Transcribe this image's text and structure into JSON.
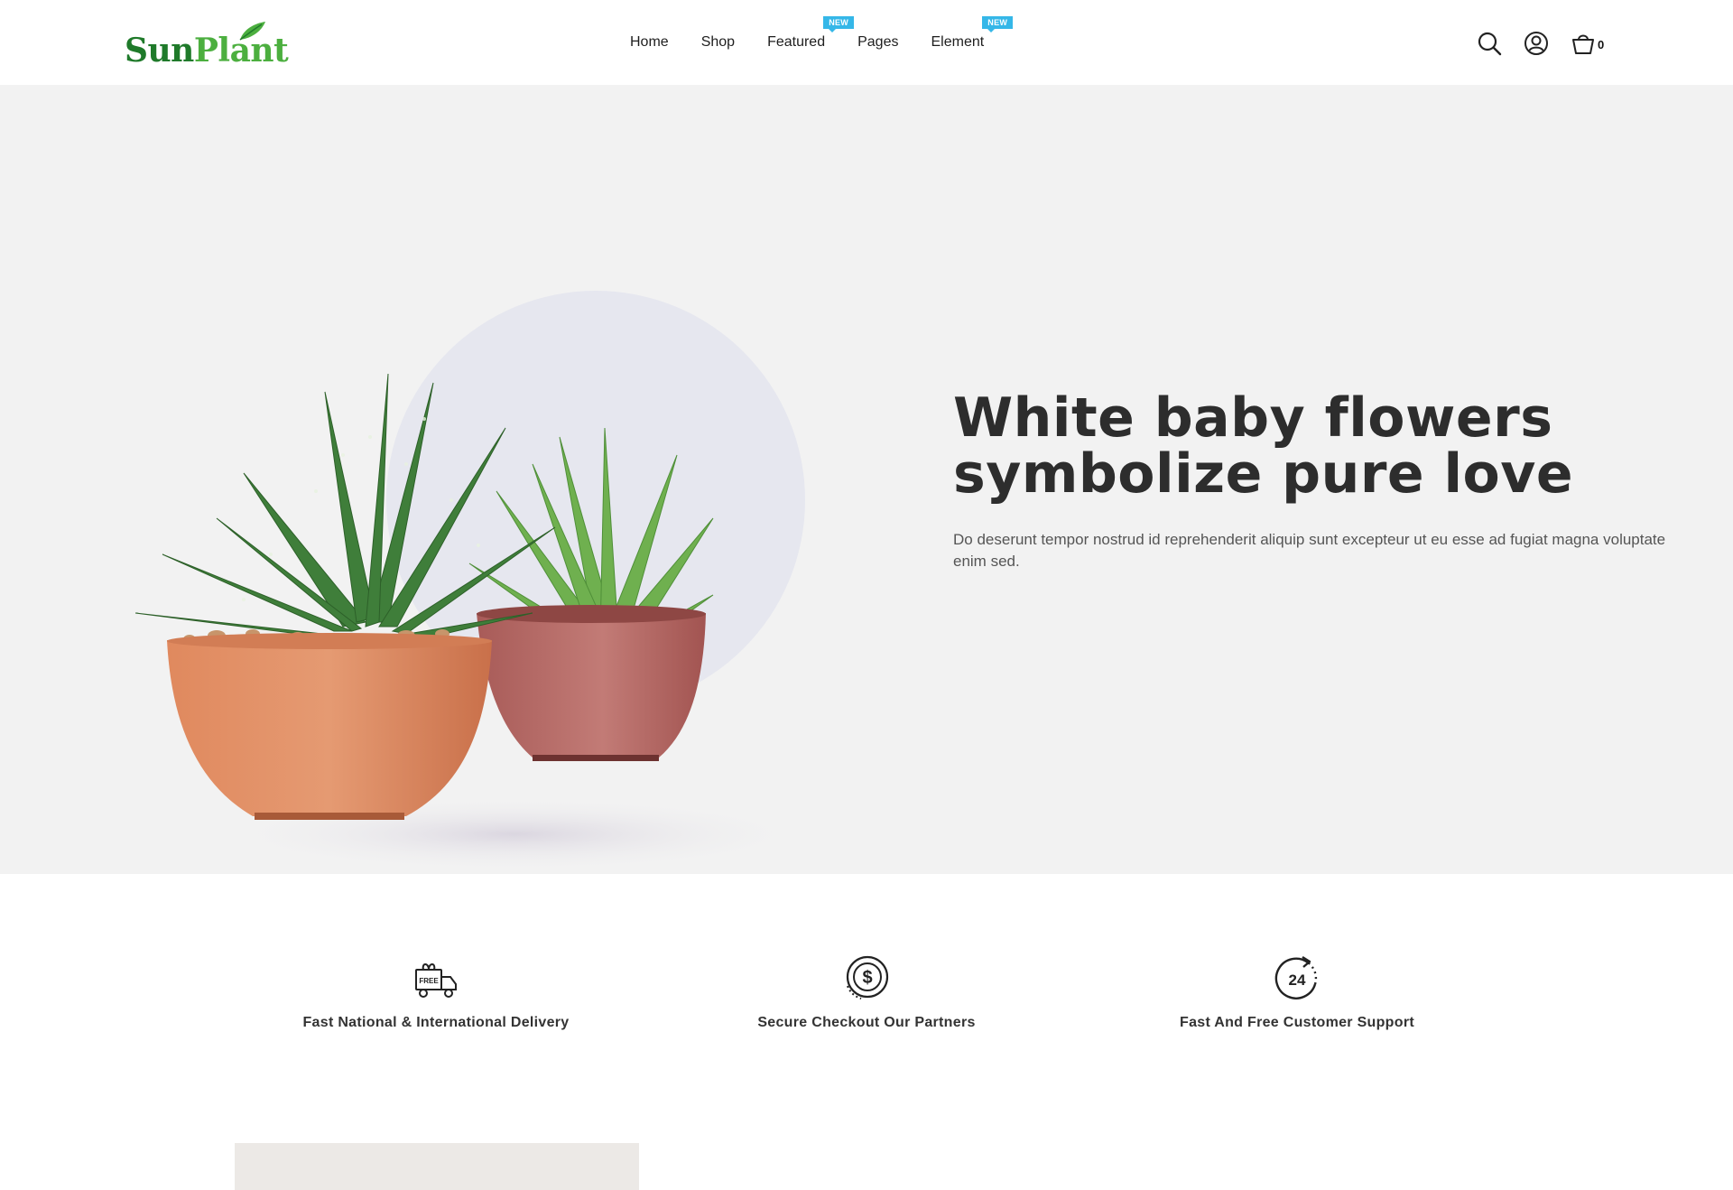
{
  "brand": {
    "name_part1": "Sun",
    "name_part2": "Plant",
    "color_dark": "#1f7a2a",
    "color_light": "#4caf3f"
  },
  "nav": {
    "items": [
      {
        "label": "Home"
      },
      {
        "label": "Shop"
      },
      {
        "label": "Featured",
        "badge": "NEW"
      },
      {
        "label": "Pages"
      },
      {
        "label": "Element",
        "badge": "NEW"
      }
    ],
    "badge_color": "#35b7e8"
  },
  "header": {
    "icons": [
      "search-icon",
      "user-account-icon",
      "shopping-basket-icon"
    ],
    "cart_count": "0"
  },
  "hero": {
    "title_line1": "White baby flowers",
    "title_line2": "symbolize pure love",
    "text": "Do deserunt tempor nostrud id reprehenderit aliquip sunt excepteur ut eu esse ad fugiat magna voluptate enim sed.",
    "background": "#f2f2f2"
  },
  "features": [
    {
      "icon": "free-delivery-truck-icon",
      "label": "Fast National & International Delivery"
    },
    {
      "icon": "secure-payment-icon",
      "label": "Secure Checkout Our Partners"
    },
    {
      "icon": "24-hour-support-icon",
      "label": "Fast And Free Customer Support"
    }
  ]
}
